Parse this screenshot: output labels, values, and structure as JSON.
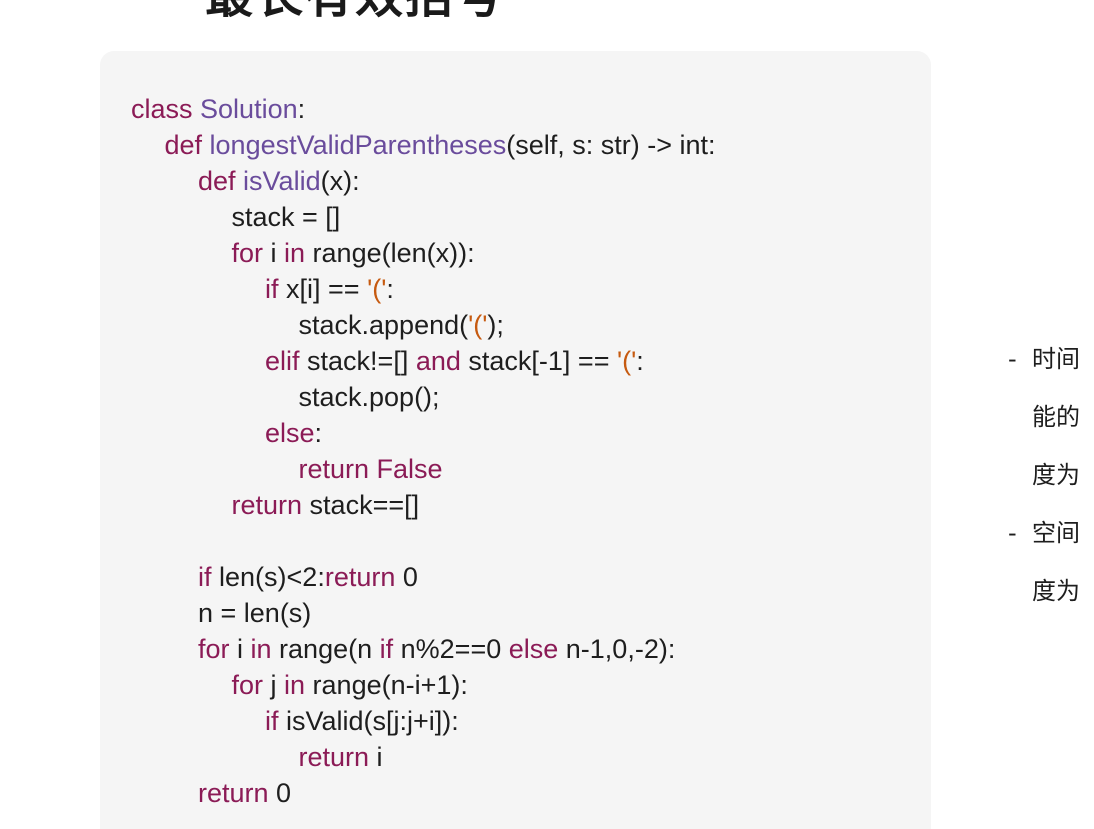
{
  "heading": {
    "text": "最长有效括号"
  },
  "code": {
    "lines": [
      {
        "indent": 0,
        "tokens": [
          {
            "t": "class ",
            "c": "kw"
          },
          {
            "t": "Solution",
            "c": "fn"
          },
          {
            "t": ":",
            "c": "tx"
          }
        ]
      },
      {
        "indent": 1,
        "tokens": [
          {
            "t": "def ",
            "c": "kw"
          },
          {
            "t": "longestValidParentheses",
            "c": "fn"
          },
          {
            "t": "(self, s: str) -> int:",
            "c": "tx"
          }
        ]
      },
      {
        "indent": 2,
        "tokens": [
          {
            "t": "def ",
            "c": "kw"
          },
          {
            "t": "isValid",
            "c": "fn"
          },
          {
            "t": "(x):",
            "c": "tx"
          }
        ]
      },
      {
        "indent": 3,
        "tokens": [
          {
            "t": "stack = []",
            "c": "tx"
          }
        ]
      },
      {
        "indent": 3,
        "tokens": [
          {
            "t": "for ",
            "c": "kw"
          },
          {
            "t": "i ",
            "c": "tx"
          },
          {
            "t": "in ",
            "c": "kw"
          },
          {
            "t": "range(len(x)):",
            "c": "tx"
          }
        ]
      },
      {
        "indent": 4,
        "tokens": [
          {
            "t": "if ",
            "c": "kw"
          },
          {
            "t": "x[i] == ",
            "c": "tx"
          },
          {
            "t": "'('",
            "c": "st"
          },
          {
            "t": ":",
            "c": "tx"
          }
        ]
      },
      {
        "indent": 5,
        "tokens": [
          {
            "t": "stack.append(",
            "c": "tx"
          },
          {
            "t": "'('",
            "c": "st"
          },
          {
            "t": ");",
            "c": "tx"
          }
        ]
      },
      {
        "indent": 4,
        "tokens": [
          {
            "t": "elif ",
            "c": "kw"
          },
          {
            "t": "stack!=[] ",
            "c": "tx"
          },
          {
            "t": "and ",
            "c": "kw"
          },
          {
            "t": "stack[-1] == ",
            "c": "tx"
          },
          {
            "t": "'('",
            "c": "st"
          },
          {
            "t": ":",
            "c": "tx"
          }
        ]
      },
      {
        "indent": 5,
        "tokens": [
          {
            "t": "stack.pop();",
            "c": "tx"
          }
        ]
      },
      {
        "indent": 4,
        "tokens": [
          {
            "t": "else",
            "c": "kw"
          },
          {
            "t": ":",
            "c": "tx"
          }
        ]
      },
      {
        "indent": 5,
        "tokens": [
          {
            "t": "return ",
            "c": "kw"
          },
          {
            "t": "False",
            "c": "kw"
          }
        ]
      },
      {
        "indent": 3,
        "tokens": [
          {
            "t": "return ",
            "c": "kw"
          },
          {
            "t": "stack==[]",
            "c": "tx"
          }
        ]
      },
      {
        "indent": 0,
        "tokens": []
      },
      {
        "indent": 2,
        "tokens": [
          {
            "t": "if ",
            "c": "kw"
          },
          {
            "t": "len(s)<2:",
            "c": "tx"
          },
          {
            "t": "return ",
            "c": "kw"
          },
          {
            "t": "0",
            "c": "tx"
          }
        ]
      },
      {
        "indent": 2,
        "tokens": [
          {
            "t": "n = len(s)",
            "c": "tx"
          }
        ]
      },
      {
        "indent": 2,
        "tokens": [
          {
            "t": "for ",
            "c": "kw"
          },
          {
            "t": "i ",
            "c": "tx"
          },
          {
            "t": "in ",
            "c": "kw"
          },
          {
            "t": "range(n ",
            "c": "tx"
          },
          {
            "t": "if ",
            "c": "kw"
          },
          {
            "t": "n%2==0 ",
            "c": "tx"
          },
          {
            "t": "else ",
            "c": "kw"
          },
          {
            "t": "n-1,0,-2):",
            "c": "tx"
          }
        ]
      },
      {
        "indent": 3,
        "tokens": [
          {
            "t": "for ",
            "c": "kw"
          },
          {
            "t": "j ",
            "c": "tx"
          },
          {
            "t": "in ",
            "c": "kw"
          },
          {
            "t": "range(n-i+1):",
            "c": "tx"
          }
        ]
      },
      {
        "indent": 4,
        "tokens": [
          {
            "t": "if ",
            "c": "kw"
          },
          {
            "t": "isValid(s[j:j+i]):",
            "c": "tx"
          }
        ]
      },
      {
        "indent": 5,
        "tokens": [
          {
            "t": "return ",
            "c": "kw"
          },
          {
            "t": "i",
            "c": "tx"
          }
        ]
      },
      {
        "indent": 2,
        "tokens": [
          {
            "t": "return ",
            "c": "kw"
          },
          {
            "t": "0",
            "c": "tx"
          }
        ]
      }
    ]
  },
  "notes": {
    "lines": [
      {
        "bullet": "-",
        "text": "时间"
      },
      {
        "bullet": "",
        "text": "能的"
      },
      {
        "bullet": "",
        "text": "度为"
      },
      {
        "bullet": "-",
        "text": "空间"
      },
      {
        "bullet": "",
        "text": "度为"
      }
    ]
  },
  "colors": {
    "keyword": "#8b1b56",
    "function": "#6a4c9c",
    "string": "#c65a10",
    "text": "#1e1e1e",
    "code_background": "#f5f5f5"
  }
}
